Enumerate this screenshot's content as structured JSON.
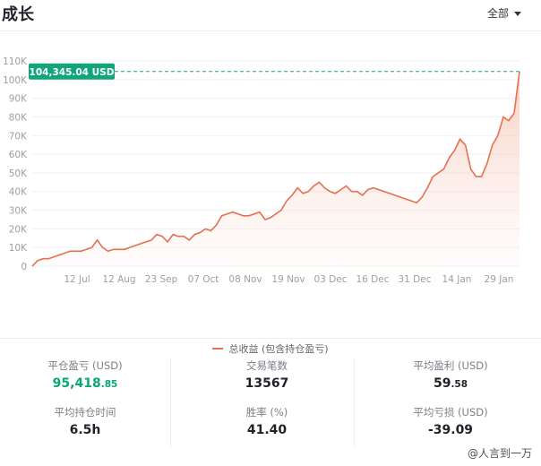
{
  "header": {
    "title": "成长",
    "filter_label": "全部"
  },
  "chart_data": {
    "type": "area",
    "y_ticks": [
      "0",
      "10K",
      "20K",
      "30K",
      "40K",
      "50K",
      "60K",
      "70K",
      "80K",
      "90K",
      "100K",
      "110K"
    ],
    "ylim": [
      0,
      110000
    ],
    "x_ticks": [
      "12 Jul",
      "12 Aug",
      "23 Sep",
      "07 Oct",
      "08 Nov",
      "19 Nov",
      "03 Dec",
      "16 Dec",
      "31 Dec",
      "14 Jan",
      "29 Jan"
    ],
    "series": [
      {
        "name": "总收益 (包含持仓盈亏)",
        "color": "#e5704f",
        "values": [
          0,
          3,
          4,
          4,
          5,
          6,
          7,
          8,
          8,
          8,
          9,
          10,
          14,
          10,
          8,
          9,
          9,
          9,
          10,
          11,
          12,
          13,
          14,
          17,
          16,
          13,
          17,
          16,
          16,
          14,
          17,
          18,
          20,
          19,
          22,
          27,
          28,
          29,
          28,
          27,
          27,
          28,
          29,
          25,
          26,
          28,
          30,
          35,
          38,
          42,
          39,
          40,
          43,
          45,
          42,
          40,
          39,
          41,
          43,
          40,
          40,
          38,
          41,
          42,
          41,
          40,
          39,
          38,
          37,
          36,
          35,
          34,
          37,
          42,
          48,
          50,
          52,
          58,
          62,
          68,
          65,
          52,
          48,
          48,
          55,
          65,
          70,
          80,
          78,
          82,
          104.345
        ]
      }
    ],
    "final_label": "104,345.04 USD"
  },
  "legend": {
    "label": "总收益 (包含持仓盈亏)"
  },
  "stats": {
    "closed_pnl_label": "平仓盈亏 (USD)",
    "closed_pnl_int": "95,418",
    "closed_pnl_dec": ".85",
    "trades_label": "交易笔数",
    "trades_value": "13567",
    "avg_profit_label": "平均盈利 (USD)",
    "avg_profit_int": "59",
    "avg_profit_dec": ".58",
    "avg_hold_label": "平均持仓时间",
    "avg_hold_value": "6.5h",
    "win_rate_label": "胜率 (%)",
    "win_rate_value": "41.40",
    "avg_loss_label": "平均亏损 (USD)",
    "avg_loss_value": "-39.09"
  },
  "watermark": "@人言到一万"
}
